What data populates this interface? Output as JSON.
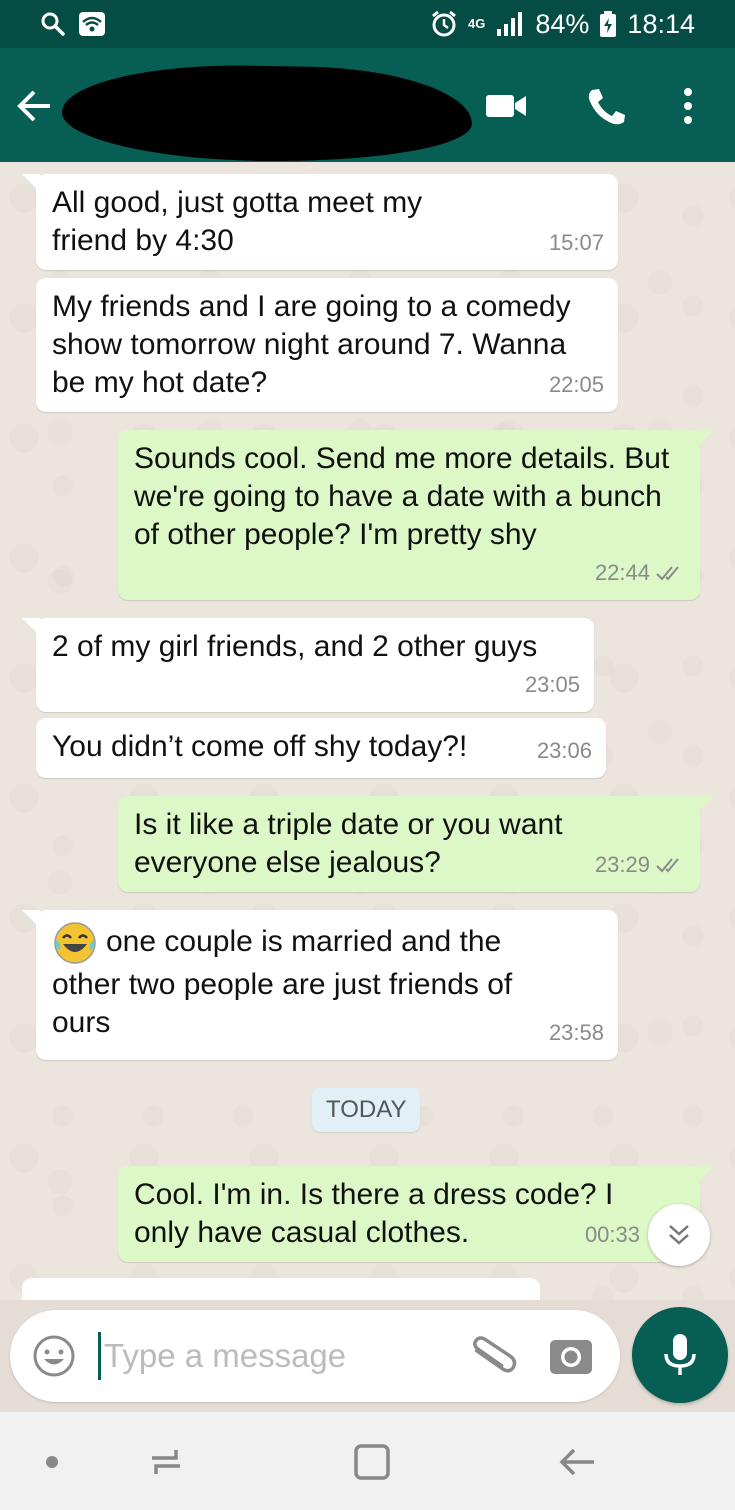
{
  "status_bar": {
    "battery": "84%",
    "time": "18:14",
    "network": "4G",
    "icons": [
      "search-icon",
      "wifi-icon",
      "alarm-icon",
      "signal-icon",
      "battery-icon"
    ]
  },
  "header": {
    "icons": [
      "back-arrow-icon",
      "video-call-icon",
      "phone-icon",
      "more-vert-icon"
    ]
  },
  "messages": [
    {
      "dir": "in",
      "text": "All good, just gotta meet my friend by 4:30",
      "time": "15:07"
    },
    {
      "dir": "in",
      "text": "My friends and I are going to a comedy show tomorrow night around 7. Wanna be my hot date?",
      "time": "22:05"
    },
    {
      "dir": "out",
      "text": "Sounds cool. Send me more details. But we're going to have a date with a bunch of other people? I'm pretty shy",
      "time": "22:44"
    },
    {
      "dir": "in",
      "text": "2 of my girl friends, and 2 other guys",
      "time": "23:05"
    },
    {
      "dir": "in",
      "text": "You didn’t come off shy today?!",
      "time": "23:06"
    },
    {
      "dir": "out",
      "text": "Is it like a triple date or you want everyone else jealous?",
      "time": "23:29"
    },
    {
      "dir": "in",
      "text": "one couple is married and the other two people are just friends of ours",
      "time": "23:58",
      "emoji": "laughing-tears-emoji"
    },
    {
      "dir": "out",
      "text": "Cool. I'm in. Is there a dress code? I only have casual clothes.",
      "time": "00:33"
    }
  ],
  "date_divider": "TODAY",
  "composer": {
    "placeholder": "Type a message"
  },
  "colors": {
    "header": "#075e54",
    "status_bar": "#054d44",
    "incoming_bubble": "#ffffff",
    "outgoing_bubble": "#dcf8c6",
    "read_ticks": "#8a8a8a"
  }
}
